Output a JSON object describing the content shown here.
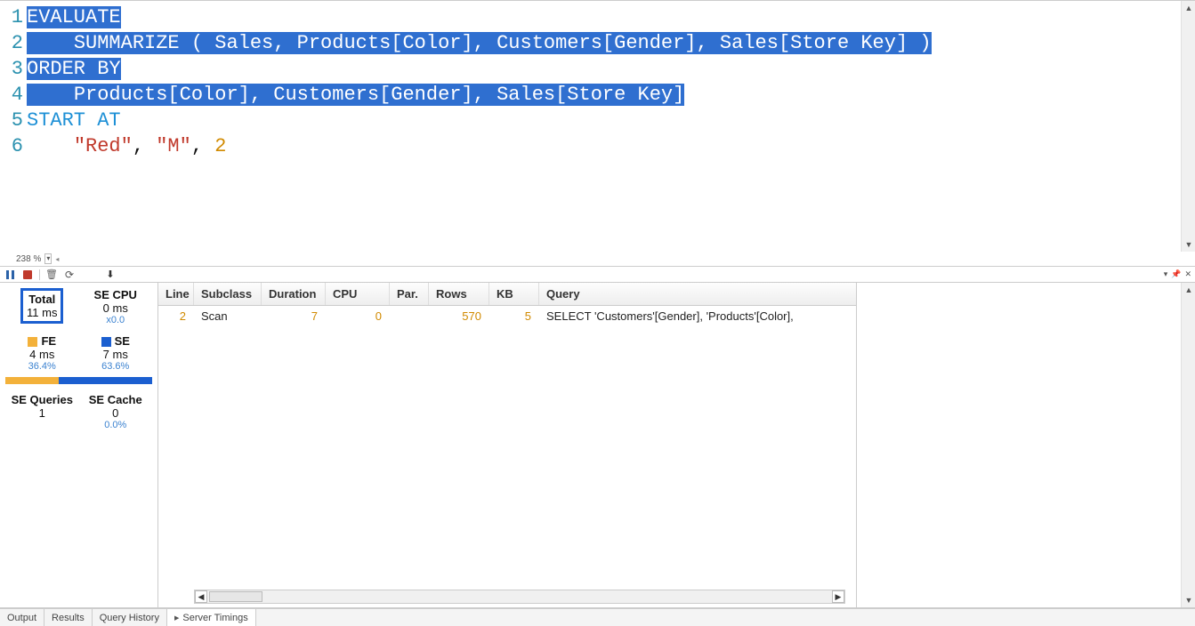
{
  "editor": {
    "zoom": "238 %",
    "lines": [
      {
        "n": 1,
        "segments": [
          {
            "t": "EVALUATE",
            "sel": true
          }
        ]
      },
      {
        "n": 2,
        "segments": [
          {
            "t": "    ",
            "sel": true
          },
          {
            "t": "SUMMARIZE ( Sales, Products[Color], Customers[Gender], Sales[Store Key] )",
            "sel": true
          }
        ]
      },
      {
        "n": 3,
        "segments": [
          {
            "t": "ORDER BY",
            "sel": true
          }
        ]
      },
      {
        "n": 4,
        "segments": [
          {
            "t": "    ",
            "sel": true
          },
          {
            "t": "Products[Color], Customers[Gender], Sales[Store Key]",
            "sel": true
          }
        ]
      },
      {
        "n": 5,
        "segments": [
          {
            "t": "START AT",
            "cls": "kw"
          }
        ]
      },
      {
        "n": 6,
        "segments": [
          {
            "t": "    ",
            "cls": "plain"
          },
          {
            "t": "\"Red\"",
            "cls": "str"
          },
          {
            "t": ", ",
            "cls": "plain"
          },
          {
            "t": "\"M\"",
            "cls": "str"
          },
          {
            "t": ", ",
            "cls": "plain"
          },
          {
            "t": "2",
            "cls": "num"
          }
        ]
      }
    ]
  },
  "stats": {
    "total_label": "Total",
    "total_value": "11 ms",
    "secpu_label": "SE CPU",
    "secpu_value": "0 ms",
    "secpu_sub": "x0.0",
    "fe_label": "FE",
    "fe_value": "4 ms",
    "fe_pct": "36.4%",
    "se_label": "SE",
    "se_value": "7 ms",
    "se_pct": "63.6%",
    "seq_label": "SE Queries",
    "seq_value": "1",
    "secache_label": "SE Cache",
    "secache_value": "0",
    "secache_sub": "0.0%",
    "fe_width": 36.4,
    "se_width": 63.6
  },
  "grid": {
    "headers": {
      "line": "Line",
      "subclass": "Subclass",
      "duration": "Duration",
      "cpu": "CPU",
      "par": "Par.",
      "rows": "Rows",
      "kb": "KB",
      "query": "Query"
    },
    "rows": [
      {
        "line": "2",
        "subclass": "Scan",
        "duration": "7",
        "cpu": "0",
        "par": "",
        "rows": "570",
        "kb": "5",
        "query": "SELECT 'Customers'[Gender], 'Products'[Color],"
      }
    ]
  },
  "tabs": {
    "output": "Output",
    "results": "Results",
    "history": "Query History",
    "timings": "Server Timings"
  }
}
